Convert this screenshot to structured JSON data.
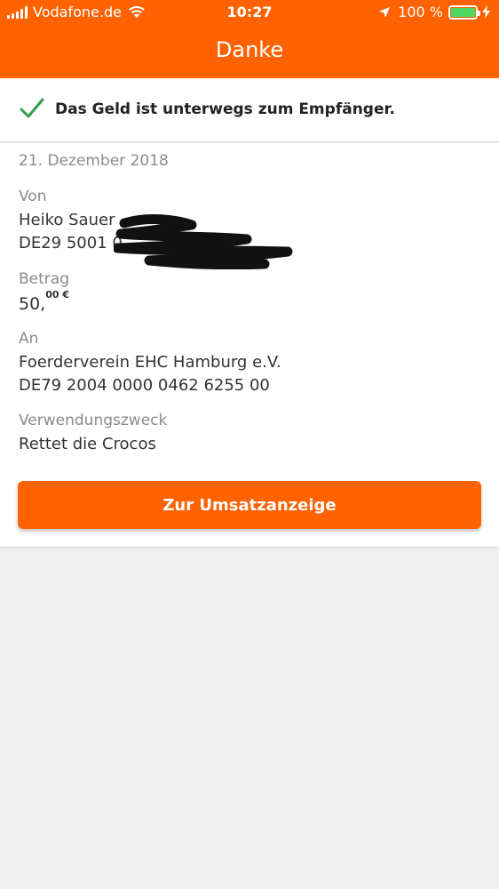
{
  "status_bar": {
    "carrier": "Vodafone.de",
    "time": "10:27",
    "battery": "100 %"
  },
  "header": {
    "title": "Danke"
  },
  "confirmation": {
    "icon": "checkmark-icon",
    "message": "Das Geld ist unterwegs zum Empfänger."
  },
  "transfer": {
    "date": "21. Dezember 2018",
    "from_label": "Von",
    "from_name": "Heiko Sauer",
    "from_iban": "DE29 5001 0",
    "amount_label": "Betrag",
    "amount_main": "50,",
    "amount_cents": "00 €",
    "to_label": "An",
    "to_name": "Foerderverein EHC Hamburg e.V.",
    "to_iban": "DE79 2004 0000 0462 6255 00",
    "purpose_label": "Verwendungszweck",
    "purpose": "Rettet die Crocos"
  },
  "actions": {
    "transactions_button": "Zur Umsatzanzeige"
  },
  "colors": {
    "brand": "#ff6200",
    "success": "#2e9b4e"
  }
}
